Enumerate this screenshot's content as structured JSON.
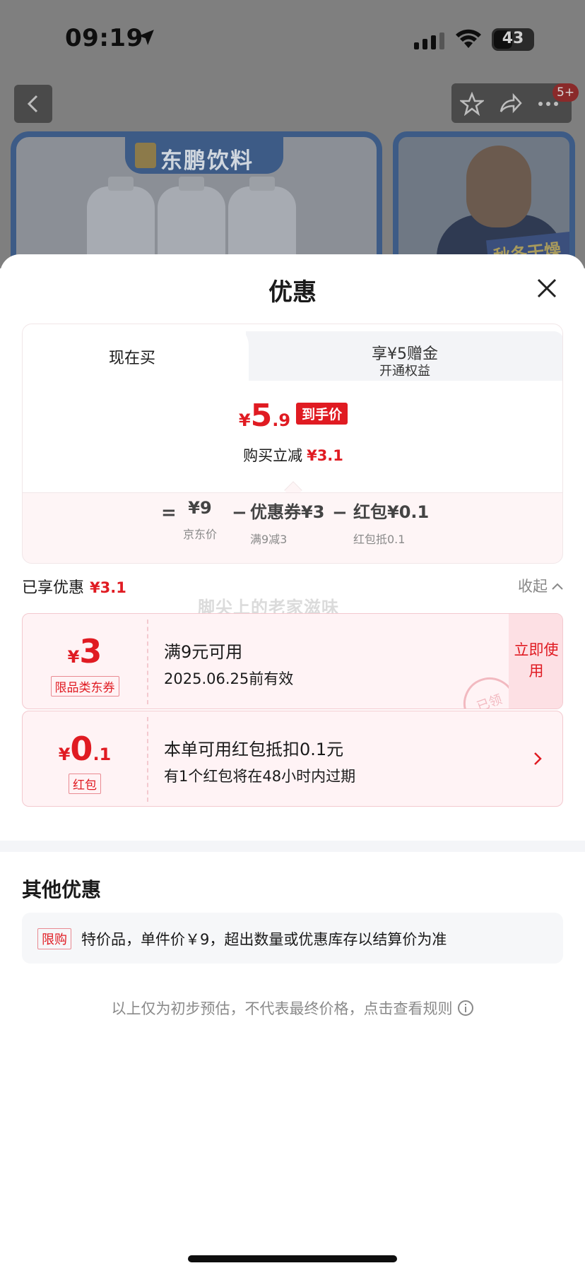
{
  "status_bar": {
    "time": "09:19",
    "battery": "43"
  },
  "background": {
    "notification_badge": "5+",
    "brand_name": "东鹏饮料",
    "promo_text": "秋冬干燥"
  },
  "sheet": {
    "title": "优惠",
    "tabs": [
      {
        "label": "现在买",
        "active": true
      },
      {
        "label": "享¥5赠金",
        "sublabel": "开通权益",
        "active": false
      }
    ],
    "final_price": {
      "currency": "¥",
      "integer": "5",
      "decimal": ".9",
      "tag": "到手价"
    },
    "saving": {
      "label": "购买立减",
      "amount": "¥3.1"
    },
    "breakdown": {
      "equals": "=",
      "minus": "−",
      "items": [
        {
          "value": "¥9",
          "caption": "京东价"
        },
        {
          "value": "优惠券¥3",
          "caption": "满9减3"
        },
        {
          "value": "红包¥0.1",
          "caption": "红包抵0.1"
        }
      ]
    },
    "enjoyed": {
      "label": "已享优惠",
      "amount": "¥3.1",
      "collapse_label": "收起"
    },
    "watermark": "脚尖上的老家滋味",
    "coupon": {
      "currency": "¥",
      "amount": "3",
      "tag": "限品类东券",
      "title": "满9元可用",
      "validity": "2025.06.25前有效",
      "action": "立即使用",
      "stamp": "已领"
    },
    "red_packet": {
      "currency": "¥",
      "amount_int": "0",
      "amount_dec": ".1",
      "tag": "红包",
      "title": "本单可用红包抵扣0.1元",
      "subtitle": "有1个红包将在48小时内过期"
    },
    "other": {
      "title": "其他优惠",
      "tag": "限购",
      "text": "特价品，单件价￥9，超出数量或优惠库存以结算价为准"
    },
    "disclaimer": "以上仅为初步预估，不代表最终价格，点击查看规则"
  },
  "colors": {
    "accent": "#e01b22",
    "accent_light": "#fde0e4",
    "card_bg": "#fff3f5"
  }
}
